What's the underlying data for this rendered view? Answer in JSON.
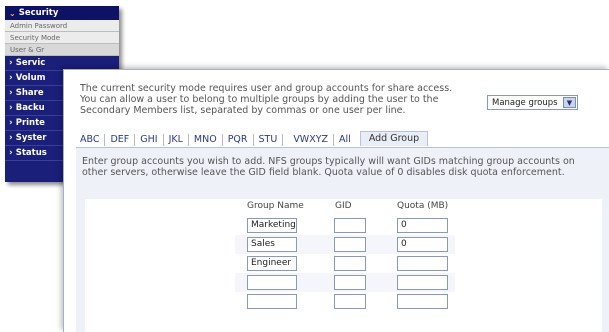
{
  "sidebar": {
    "header": "Security",
    "sub_items": [
      "Admin Password",
      "Security Mode",
      "User & Gr"
    ],
    "items": [
      "Servic",
      "Volum",
      "Share",
      "Backu",
      "Printe",
      "Syster",
      "Status"
    ]
  },
  "panel": {
    "intro": "The current security mode requires user and group accounts for share access. You can allow a user to belong to multiple groups by adding the user to the Secondary Members list, separated by commas or one user per line.",
    "groups_select": "Manage groups",
    "tabs": [
      "ABC",
      "DEF",
      "GHI",
      "JKL",
      "MNO",
      "PQR",
      "STU",
      "VWXYZ",
      "All"
    ],
    "active_tab": "Add Group",
    "note": "Enter group accounts you wish to add. NFS groups typically will want GIDs matching group accounts on other servers, otherwise leave the GID field blank. Quota value of 0 disables disk quota enforcement.",
    "columns": {
      "name": "Group Name",
      "gid": "GID",
      "quota": "Quota (MB)"
    },
    "rows": [
      {
        "name": "Marketing",
        "gid": "",
        "quota": "0"
      },
      {
        "name": "Sales",
        "gid": "",
        "quota": "0"
      },
      {
        "name": "Engineer",
        "gid": "",
        "quota": ""
      },
      {
        "name": "",
        "gid": "",
        "quota": ""
      },
      {
        "name": "",
        "gid": "",
        "quota": ""
      }
    ]
  }
}
